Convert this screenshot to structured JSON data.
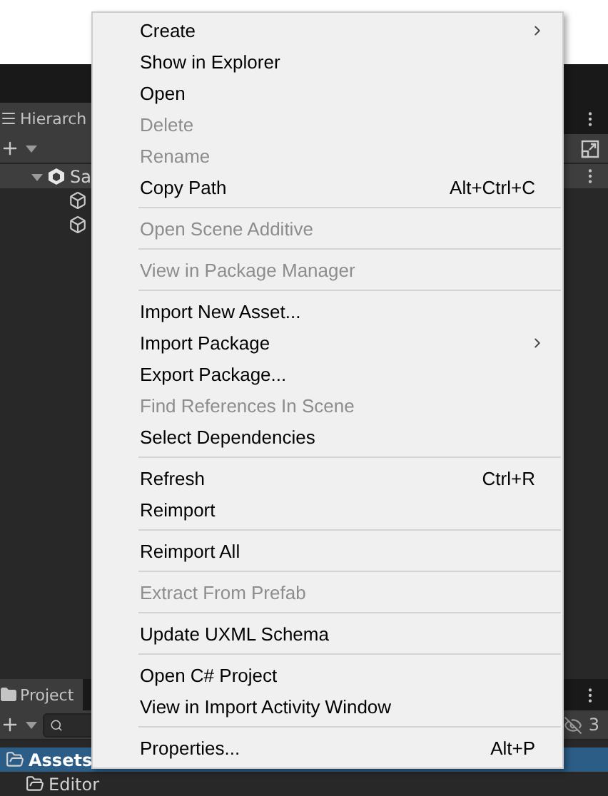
{
  "hierarchy": {
    "title": "Hierarch",
    "scene_row": {
      "label": "Sa",
      "expanded": true
    },
    "objects": [
      {
        "kind": "object"
      },
      {
        "kind": "object"
      }
    ]
  },
  "project": {
    "title": "Project",
    "hidden_count": "3",
    "folders": [
      {
        "label": "Assets",
        "selected": true
      },
      {
        "label": "Editor",
        "selected": false
      }
    ]
  },
  "context_menu": {
    "items": [
      {
        "kind": "item",
        "label": "Create",
        "disabled": false,
        "submenu": true
      },
      {
        "kind": "item",
        "label": "Show in Explorer",
        "disabled": false,
        "submenu": false
      },
      {
        "kind": "item",
        "label": "Open",
        "disabled": false,
        "submenu": false
      },
      {
        "kind": "item",
        "label": "Delete",
        "disabled": true,
        "submenu": false
      },
      {
        "kind": "item",
        "label": "Rename",
        "disabled": true,
        "submenu": false
      },
      {
        "kind": "item",
        "label": "Copy Path",
        "disabled": false,
        "submenu": false,
        "shortcut": "Alt+Ctrl+C"
      },
      {
        "kind": "separator"
      },
      {
        "kind": "item",
        "label": "Open Scene Additive",
        "disabled": true,
        "submenu": false
      },
      {
        "kind": "separator"
      },
      {
        "kind": "item",
        "label": "View in Package Manager",
        "disabled": true,
        "submenu": false
      },
      {
        "kind": "separator"
      },
      {
        "kind": "item",
        "label": "Import New Asset...",
        "disabled": false,
        "submenu": false
      },
      {
        "kind": "item",
        "label": "Import Package",
        "disabled": false,
        "submenu": true
      },
      {
        "kind": "item",
        "label": "Export Package...",
        "disabled": false,
        "submenu": false
      },
      {
        "kind": "item",
        "label": "Find References In Scene",
        "disabled": true,
        "submenu": false
      },
      {
        "kind": "item",
        "label": "Select Dependencies",
        "disabled": false,
        "submenu": false
      },
      {
        "kind": "separator"
      },
      {
        "kind": "item",
        "label": "Refresh",
        "disabled": false,
        "submenu": false,
        "shortcut": "Ctrl+R"
      },
      {
        "kind": "item",
        "label": "Reimport",
        "disabled": false,
        "submenu": false
      },
      {
        "kind": "separator"
      },
      {
        "kind": "item",
        "label": "Reimport All",
        "disabled": false,
        "submenu": false
      },
      {
        "kind": "separator"
      },
      {
        "kind": "item",
        "label": "Extract From Prefab",
        "disabled": true,
        "submenu": false
      },
      {
        "kind": "separator"
      },
      {
        "kind": "item",
        "label": "Update UXML Schema",
        "disabled": false,
        "submenu": false
      },
      {
        "kind": "separator"
      },
      {
        "kind": "item",
        "label": "Open C# Project",
        "disabled": false,
        "submenu": false
      },
      {
        "kind": "item",
        "label": "View in Import Activity Window",
        "disabled": false,
        "submenu": false
      },
      {
        "kind": "separator"
      },
      {
        "kind": "item",
        "label": "Properties...",
        "disabled": false,
        "submenu": false,
        "shortcut": "Alt+P"
      }
    ]
  }
}
